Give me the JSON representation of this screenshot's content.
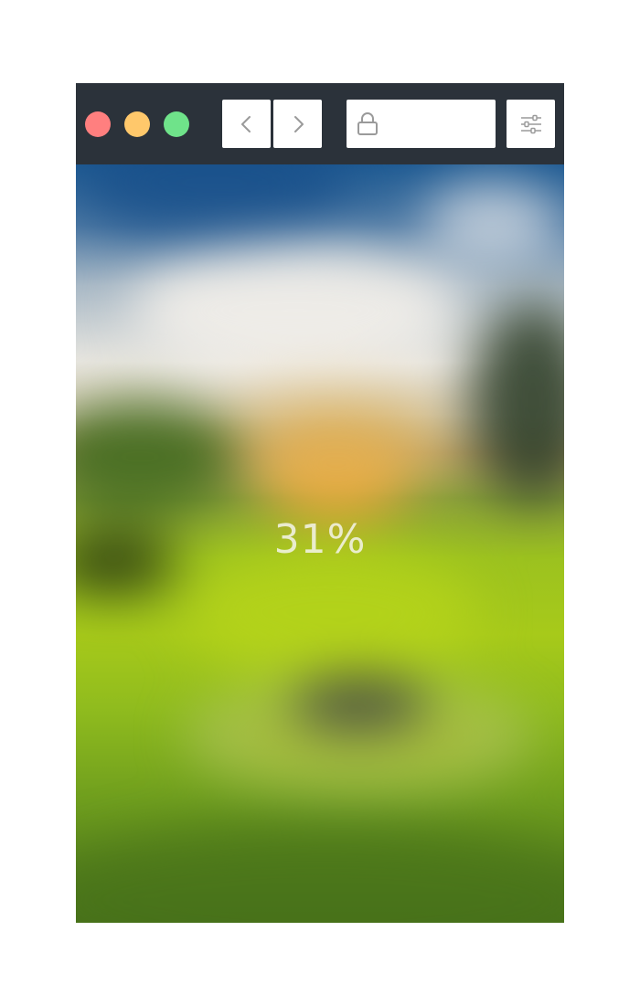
{
  "window": {
    "traffic_lights": {
      "close_color": "#ff7f7f",
      "minimize_color": "#ffc86b",
      "maximize_color": "#6fe38a"
    }
  },
  "toolbar": {
    "background": "#2b323a",
    "back_icon": "chevron-left-icon",
    "forward_icon": "chevron-right-icon",
    "address": {
      "icon": "lock-icon",
      "value": ""
    },
    "settings_icon": "sliders-icon"
  },
  "viewport": {
    "content": "blurred-landscape-image",
    "loading_percent_value": 31,
    "loading_percent_text": "31%"
  }
}
